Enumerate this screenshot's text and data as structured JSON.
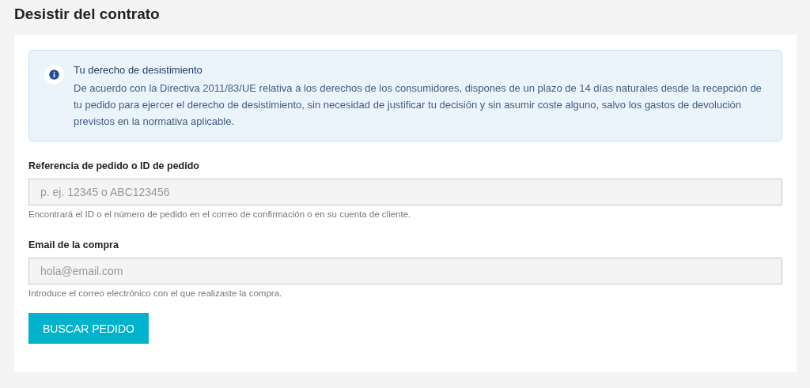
{
  "page": {
    "title": "Desistir del contrato"
  },
  "notice": {
    "title": "Tu derecho de desistimiento",
    "body": "De acuerdo con la Directiva 2011/83/UE relativa a los derechos de los consumidores, dispones de un plazo de 14 días naturales desde la recepción de tu pedido para ejercer el derecho de desistimiento, sin necesidad de justificar tu decisión y sin asumir coste alguno, salvo los gastos de devolución previstos en la normativa aplicable."
  },
  "fields": [
    {
      "label": "Referencia de pedido o ID de pedido",
      "placeholder": "p. ej. 12345 o ABC123456",
      "help": "Encontrará el ID o el número de pedido en el correo de confirmación o en su cuenta de cliente."
    },
    {
      "label": "Email de la compra",
      "placeholder": "hola@email.com",
      "help": "Introduce el correo electrónico con el que realizaste la compra."
    }
  ],
  "button": {
    "label": "BUSCAR PEDIDO"
  }
}
